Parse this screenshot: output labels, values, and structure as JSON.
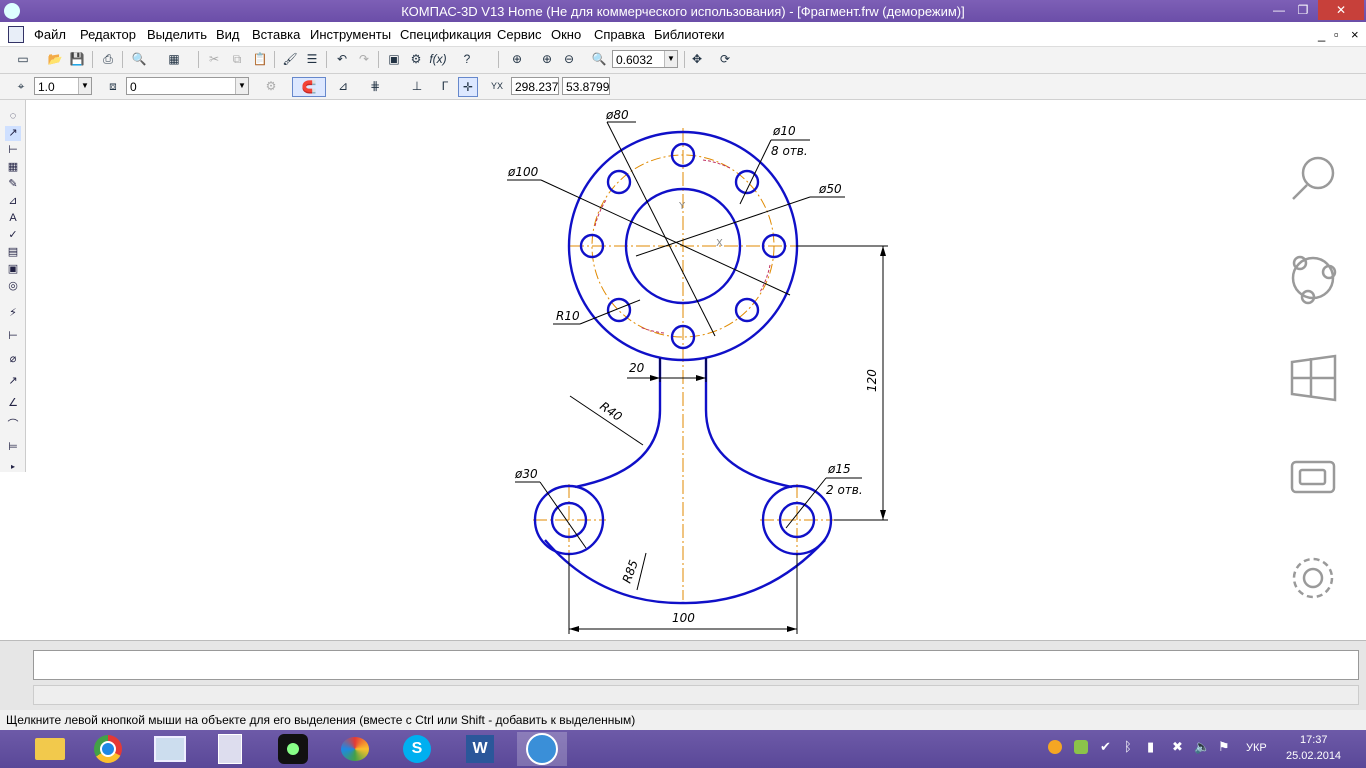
{
  "window": {
    "title": "КОМПАС-3D V13 Home (Не для коммерческого использования) - [Фрагмент.frw (деморежим)]",
    "minimize": "—",
    "restore": "❐",
    "close": "✕"
  },
  "menu": {
    "items": [
      "Файл",
      "Редактор",
      "Выделить",
      "Вид",
      "Вставка",
      "Инструменты",
      "Спецификация",
      "Сервис",
      "Окно",
      "Справка",
      "Библиотеки"
    ],
    "doc_controls": [
      "_",
      "▫",
      "×"
    ]
  },
  "toolbar1": {
    "zoom_value": "0.6032"
  },
  "toolbar2": {
    "step_value": "1.0",
    "layer_value": "0",
    "coord_x": "298.237",
    "coord_y": "53.8799"
  },
  "drawing": {
    "dims": {
      "d80": "ø80",
      "d10": "ø10",
      "holes8": "8 отв.",
      "d100": "ø100",
      "d50": "ø50",
      "r10": "R10",
      "w20": "20",
      "v120": "120",
      "r40": "R40",
      "d30": "ø30",
      "d15": "ø15",
      "holes2": "2 отв.",
      "r85": "R85",
      "w100": "100",
      "axis_x": "X",
      "axis_y": "Y"
    },
    "colors": {
      "contour": "#1010c8",
      "axis": "#e08a00",
      "dimension": "#000000",
      "hatch": "#c03060"
    }
  },
  "charms": [
    "search-icon",
    "share-icon",
    "start-icon",
    "devices-icon",
    "settings-icon"
  ],
  "status": {
    "hint": "Щелкните левой кнопкой мыши на объекте для его выделения (вместе с Ctrl или Shift - добавить к выделенным)"
  },
  "taskbar": {
    "apps": [
      "file-explorer-icon",
      "chrome-icon",
      "monitor-icon",
      "calculator-icon",
      "camera-icon",
      "paint-icon",
      "skype-icon",
      "word-icon",
      "kompas-icon"
    ],
    "language": "УКР",
    "time": "17:37",
    "date": "25.02.2014"
  }
}
